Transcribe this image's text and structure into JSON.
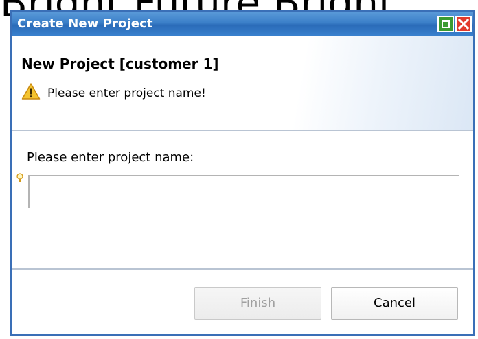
{
  "background": {
    "text": "Bright Future Bright"
  },
  "window": {
    "title": "Create New Project"
  },
  "header": {
    "title": "New Project [customer 1]",
    "message": "Please enter project name!",
    "message_icon": "warning-icon"
  },
  "form": {
    "project_name_label": "Please enter project name:",
    "project_name_value": "",
    "project_name_icon": "lightbulb-hint-icon"
  },
  "buttons": {
    "finish_label": "Finish",
    "finish_enabled": false,
    "cancel_label": "Cancel"
  },
  "colors": {
    "titlebar": "#3b7fc8",
    "close_button": "#e23a2c",
    "maximize_button": "#3b9b31"
  }
}
